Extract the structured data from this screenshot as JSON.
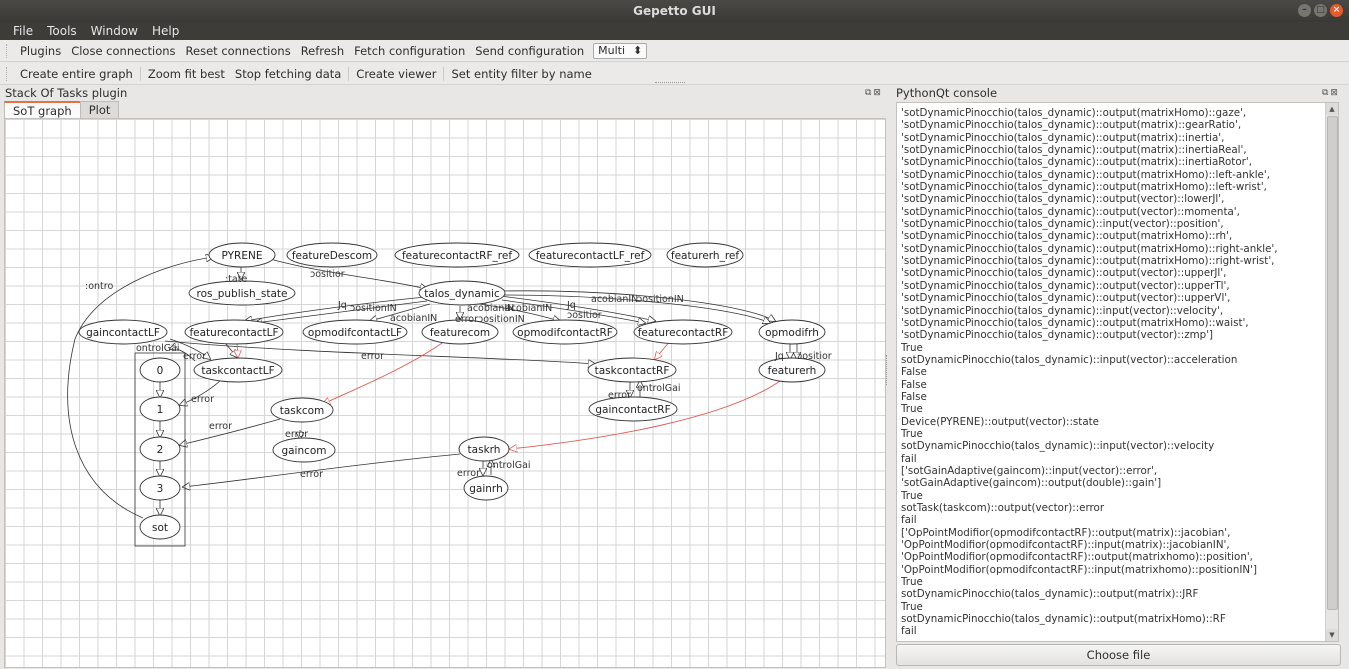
{
  "window": {
    "title": "Gepetto GUI"
  },
  "menu": [
    "File",
    "Tools",
    "Window",
    "Help"
  ],
  "toolbar1": {
    "items": [
      "Plugins",
      "Close connections",
      "Reset connections",
      "Refresh",
      "Fetch configuration",
      "Send configuration"
    ],
    "combo_value": "Multi"
  },
  "toolbar2": {
    "items": [
      "Create entire graph",
      "Zoom fit best",
      "Stop fetching data",
      "Create viewer",
      "Set entity filter by name"
    ]
  },
  "left_panel": {
    "title": "Stack Of Tasks plugin",
    "tabs": [
      "SoT graph",
      "Plot"
    ]
  },
  "right_panel": {
    "title": "PythonQt console",
    "choose_file": "Choose file"
  },
  "graph": {
    "nodes": {
      "pyrene": "PYRENE",
      "featureDescom": "featureDescom",
      "featurecontactRF_ref": "featurecontactRF_ref",
      "featurecontactLF_ref": "featurecontactLF_ref",
      "featurerh_ref": "featurerh_ref",
      "ros_publish_state": "ros_publish_state",
      "talos_dynamic": "talos_dynamic",
      "gaincontactLF": "gaincontactLF",
      "featurecontactLF": "featurecontactLF",
      "opmodifcontactLF": "opmodifcontactLF",
      "featurecom": "featurecom",
      "opmodifcontactRF": "opmodifcontactRF",
      "featurecontactRF": "featurecontactRF",
      "opmodifrh": "opmodifrh",
      "taskcontactLF": "taskcontactLF",
      "taskcontactRF": "taskcontactRF",
      "featurerh": "featurerh",
      "gaincontactRF": "gaincontactRF",
      "taskcom": "taskcom",
      "gaincom": "gaincom",
      "taskrh": "taskrh",
      "gainrh": "gainrh",
      "s0": "0",
      "s1": "1",
      "s2": "2",
      "s3": "3",
      "sot": "sot"
    },
    "edge_labels": {
      "contro": ":ontro",
      "state": ":tate",
      "position1": "ɔositior",
      "jq": "Jq",
      "positionIN1": "ɔositionIN",
      "jacobianIN1": "acobianIN",
      "jacobianIN2": "acobianIN",
      "jacobianIN3": "acobianIN",
      "errorposition": "errorɔositionIN",
      "jq2": "Jq",
      "position2": "ɔositior",
      "jacobianIN4": "acobianIN",
      "positionIN2": "ɔositionIN",
      "controlGain1": "ontrolGai",
      "error1": "error",
      "error2": "error",
      "error3": "error",
      "error4": "error",
      "error5": "error",
      "error6": "error",
      "error7": "error",
      "error8": "error",
      "controlGain2": "ontrolGai",
      "controlGain3": "ontrolGai",
      "jq3": "Jq",
      "position3": "ɔositior"
    }
  },
  "console_lines": [
    "'sotDynamicPinocchio(talos_dynamic)::output(matrixHomo)::gaze',",
    "'sotDynamicPinocchio(talos_dynamic)::output(matrix)::gearRatio',",
    "'sotDynamicPinocchio(talos_dynamic)::output(matrix)::inertia',",
    "'sotDynamicPinocchio(talos_dynamic)::output(matrix)::inertiaReal',",
    "'sotDynamicPinocchio(talos_dynamic)::output(matrix)::inertiaRotor',",
    "'sotDynamicPinocchio(talos_dynamic)::output(matrixHomo)::left-ankle',",
    "'sotDynamicPinocchio(talos_dynamic)::output(matrixHomo)::left-wrist',",
    "'sotDynamicPinocchio(talos_dynamic)::output(vector)::lowerJl',",
    "'sotDynamicPinocchio(talos_dynamic)::output(vector)::momenta',",
    "'sotDynamicPinocchio(talos_dynamic)::input(vector)::position',",
    "'sotDynamicPinocchio(talos_dynamic)::output(matrixHomo)::rh',",
    "'sotDynamicPinocchio(talos_dynamic)::output(matrixHomo)::right-ankle',",
    "'sotDynamicPinocchio(talos_dynamic)::output(matrixHomo)::right-wrist',",
    "'sotDynamicPinocchio(talos_dynamic)::output(vector)::upperJl',",
    "'sotDynamicPinocchio(talos_dynamic)::output(vector)::upperTl',",
    "'sotDynamicPinocchio(talos_dynamic)::output(vector)::upperVl',",
    "'sotDynamicPinocchio(talos_dynamic)::input(vector)::velocity',",
    "'sotDynamicPinocchio(talos_dynamic)::output(matrixHomo)::waist',",
    "'sotDynamicPinocchio(talos_dynamic)::output(vector)::zmp']",
    "True",
    "sotDynamicPinocchio(talos_dynamic)::input(vector)::acceleration",
    "False",
    "False",
    "False",
    "True",
    "Device(PYRENE)::output(vector)::state",
    "True",
    "sotDynamicPinocchio(talos_dynamic)::input(vector)::velocity",
    "fail",
    "['sotGainAdaptive(gaincom)::input(vector)::error',",
    "'sotGainAdaptive(gaincom)::output(double)::gain']",
    "True",
    "sotTask(taskcom)::output(vector)::error",
    "fail",
    "['OpPointModifior(opmodifcontactRF)::output(matrix)::jacobian',",
    "'OpPointModifior(opmodifcontactRF)::input(matrix)::jacobianIN',",
    "'OpPointModifior(opmodifcontactRF)::output(matrixhomo)::position',",
    "'OpPointModifior(opmodifcontactRF)::input(matrixhomo)::positionIN']",
    "True",
    "sotDynamicPinocchio(talos_dynamic)::output(matrix)::JRF",
    "True",
    "sotDynamicPinocchio(talos_dynamic)::output(matrixHomo)::RF",
    "fail"
  ],
  "colors": {
    "accent_tab": "#e57245",
    "error_edge": "#e05a4e",
    "close_button": "#e65a2b"
  }
}
